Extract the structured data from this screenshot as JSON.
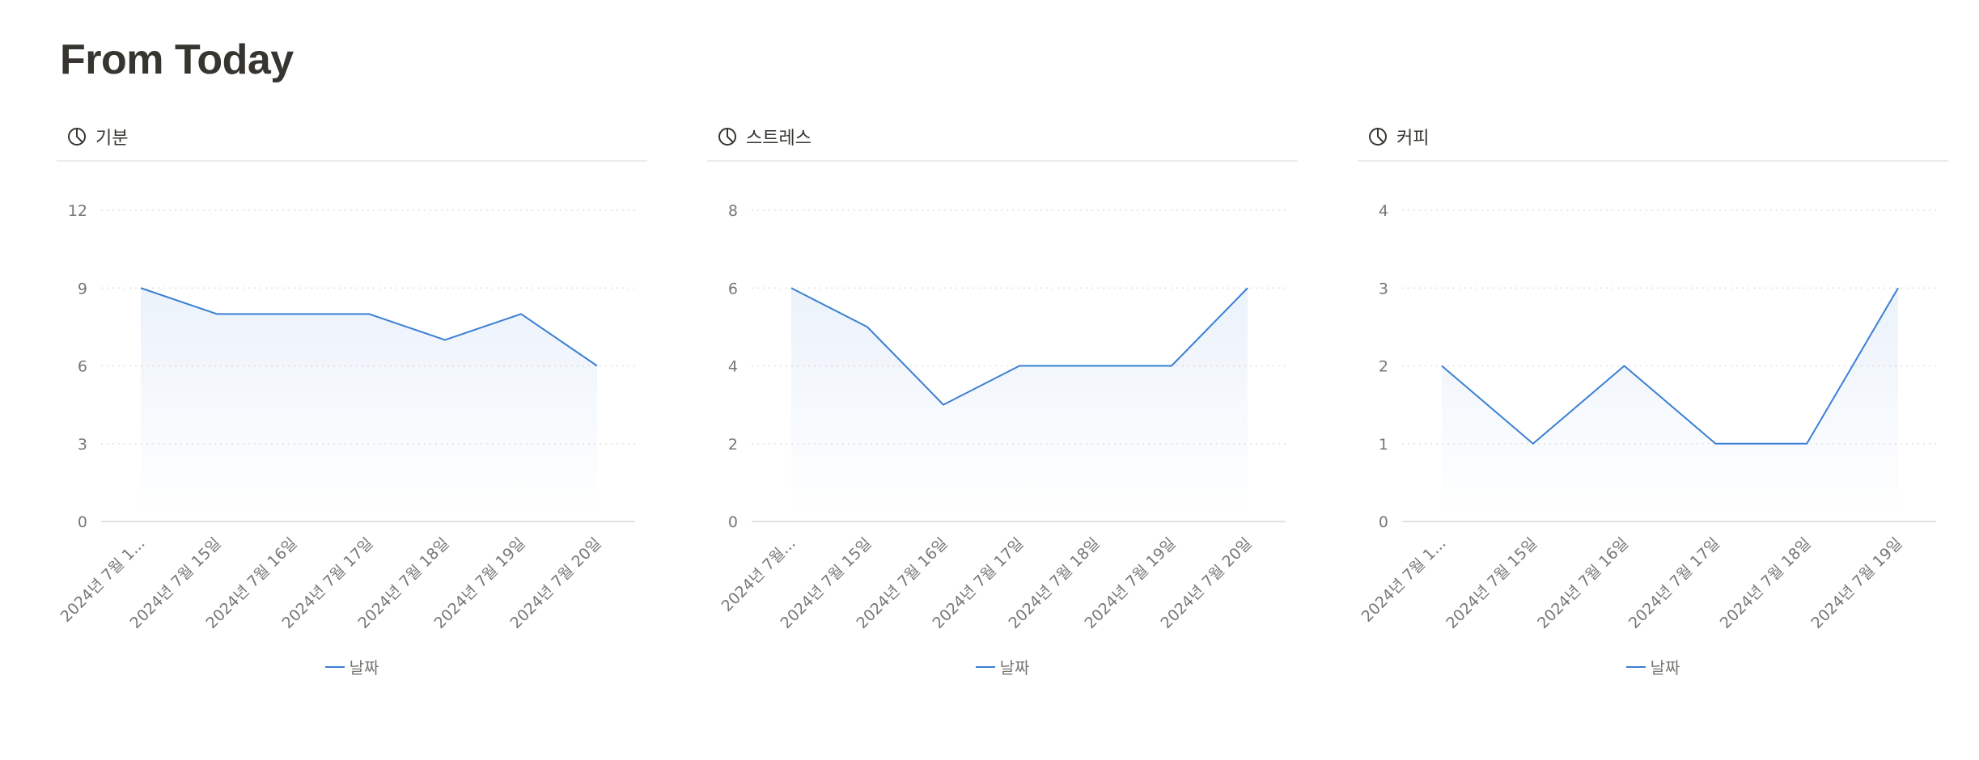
{
  "page": {
    "title": "From Today"
  },
  "colors": {
    "line": "#3b7fd4",
    "grid": "#e3e2e0",
    "axis": "#e3e2e0",
    "tick": "#787774"
  },
  "icons": {
    "panel": "pie-chart-icon"
  },
  "panels": [
    {
      "title": "기분"
    },
    {
      "title": "스트레스"
    },
    {
      "title": "커피"
    }
  ],
  "chart_data": [
    {
      "type": "area",
      "title": "기분",
      "categories": [
        "2024년 7월 1...",
        "2024년 7월 15일",
        "2024년 7월 16일",
        "2024년 7월 17일",
        "2024년 7월 18일",
        "2024년 7월 19일",
        "2024년 7월 20일"
      ],
      "series": [
        {
          "name": "날짜",
          "values": [
            9,
            8,
            8,
            8,
            7,
            8,
            6
          ]
        }
      ],
      "ylim": [
        0,
        12
      ],
      "yticks": [
        0,
        3,
        6,
        9,
        12
      ],
      "grid": true,
      "legend": "bottom-center"
    },
    {
      "type": "area",
      "title": "스트레스",
      "categories": [
        "2024년 7월...",
        "2024년 7월 15일",
        "2024년 7월 16일",
        "2024년 7월 17일",
        "2024년 7월 18일",
        "2024년 7월 19일",
        "2024년 7월 20일"
      ],
      "series": [
        {
          "name": "날짜",
          "values": [
            6,
            5,
            3,
            4,
            4,
            4,
            6
          ]
        }
      ],
      "ylim": [
        0,
        8
      ],
      "yticks": [
        0,
        2,
        4,
        6,
        8
      ],
      "grid": true,
      "legend": "bottom-center"
    },
    {
      "type": "area",
      "title": "커피",
      "categories": [
        "2024년 7월 1...",
        "2024년 7월 15일",
        "2024년 7월 16일",
        "2024년 7월 17일",
        "2024년 7월 18일",
        "2024년 7월 19일"
      ],
      "series": [
        {
          "name": "날짜",
          "values": [
            2,
            1,
            2,
            1,
            1,
            3
          ]
        }
      ],
      "ylim": [
        0,
        4
      ],
      "yticks": [
        0,
        1,
        2,
        3,
        4
      ],
      "grid": true,
      "legend": "bottom-center"
    }
  ]
}
